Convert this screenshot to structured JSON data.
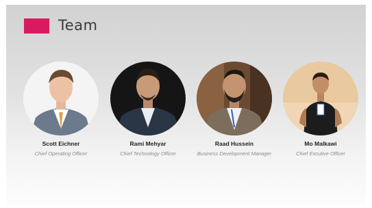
{
  "slide": {
    "title": "Team",
    "accent_color": "#d81b60"
  },
  "team": [
    {
      "name": "Scott Eichner",
      "role": "Chief Operating Officer"
    },
    {
      "name": "Rami Mehyar",
      "role": "Chief Technology Officer"
    },
    {
      "name": "Raad Hussein",
      "role": "Business Development Manager"
    },
    {
      "name": "Mo Malkawi",
      "role": "Chief Excutive Officer"
    }
  ]
}
